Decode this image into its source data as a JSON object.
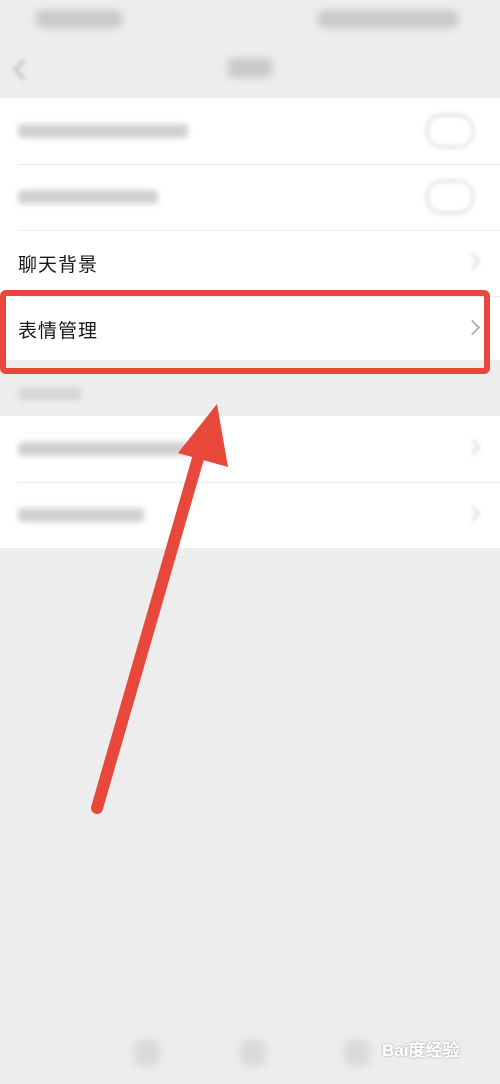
{
  "settings": {
    "chat_background_label": "聊天背景",
    "sticker_management_label": "表情管理"
  },
  "annotation": {
    "highlight_color": "#e8473b",
    "arrow_color": "#e8473b"
  },
  "icons": [
    "back-arrow-icon",
    "chevron-right-icon",
    "toggle-icon"
  ],
  "watermark": {
    "text": "Bai度经验"
  }
}
